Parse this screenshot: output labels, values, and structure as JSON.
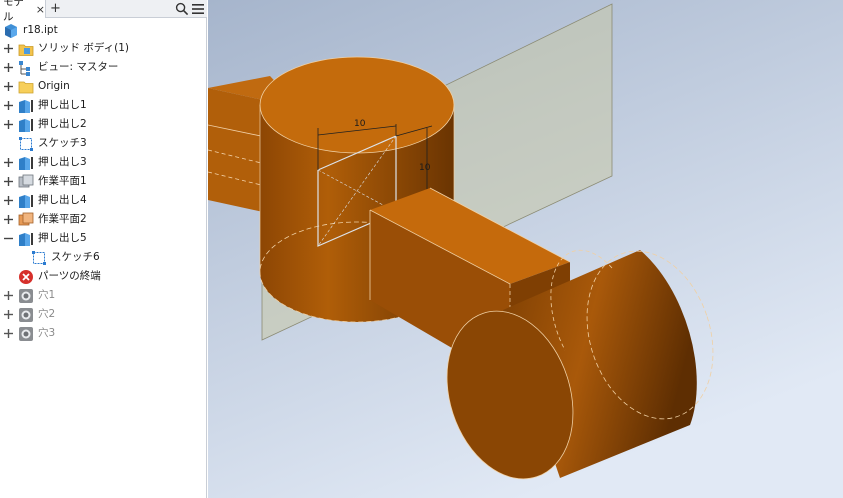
{
  "browser": {
    "tab_label": "モデル",
    "tab_close": "×",
    "tab_add": "+",
    "search_icon": "search-icon",
    "menu_icon": "hamburger-menu-icon"
  },
  "tree": {
    "root": "r18.ipt",
    "items": [
      {
        "label": "ソリッド ボディ(1)",
        "icon": "solid-bodies-folder-icon"
      },
      {
        "label": "ビュー: マスター",
        "icon": "view-representation-icon"
      },
      {
        "label": "Origin",
        "icon": "folder-icon"
      },
      {
        "label": "押し出し1",
        "icon": "extrude-icon"
      },
      {
        "label": "押し出し2",
        "icon": "extrude-icon"
      },
      {
        "label": "スケッチ3",
        "icon": "sketch-icon"
      },
      {
        "label": "押し出し3",
        "icon": "extrude-icon"
      },
      {
        "label": "作業平面1",
        "icon": "work-plane-icon"
      },
      {
        "label": "押し出し4",
        "icon": "extrude-icon"
      },
      {
        "label": "作業平面2",
        "icon": "work-plane-icon"
      },
      {
        "label": "押し出し5",
        "icon": "extrude-icon"
      },
      {
        "label": "スケッチ6",
        "icon": "sketch-icon"
      },
      {
        "label": "パーツの終端",
        "icon": "end-of-part-icon"
      },
      {
        "label": "穴1",
        "icon": "hole-icon"
      },
      {
        "label": "穴2",
        "icon": "hole-icon"
      },
      {
        "label": "穴3",
        "icon": "hole-icon"
      }
    ]
  },
  "viewport": {
    "dimension_horizontal": "10",
    "dimension_vertical": "10",
    "part_color": "#C56A0C",
    "plane_color": "#C9C9A8",
    "background_top": "#A9B7CD",
    "background_bottom": "#DDE6F4"
  }
}
